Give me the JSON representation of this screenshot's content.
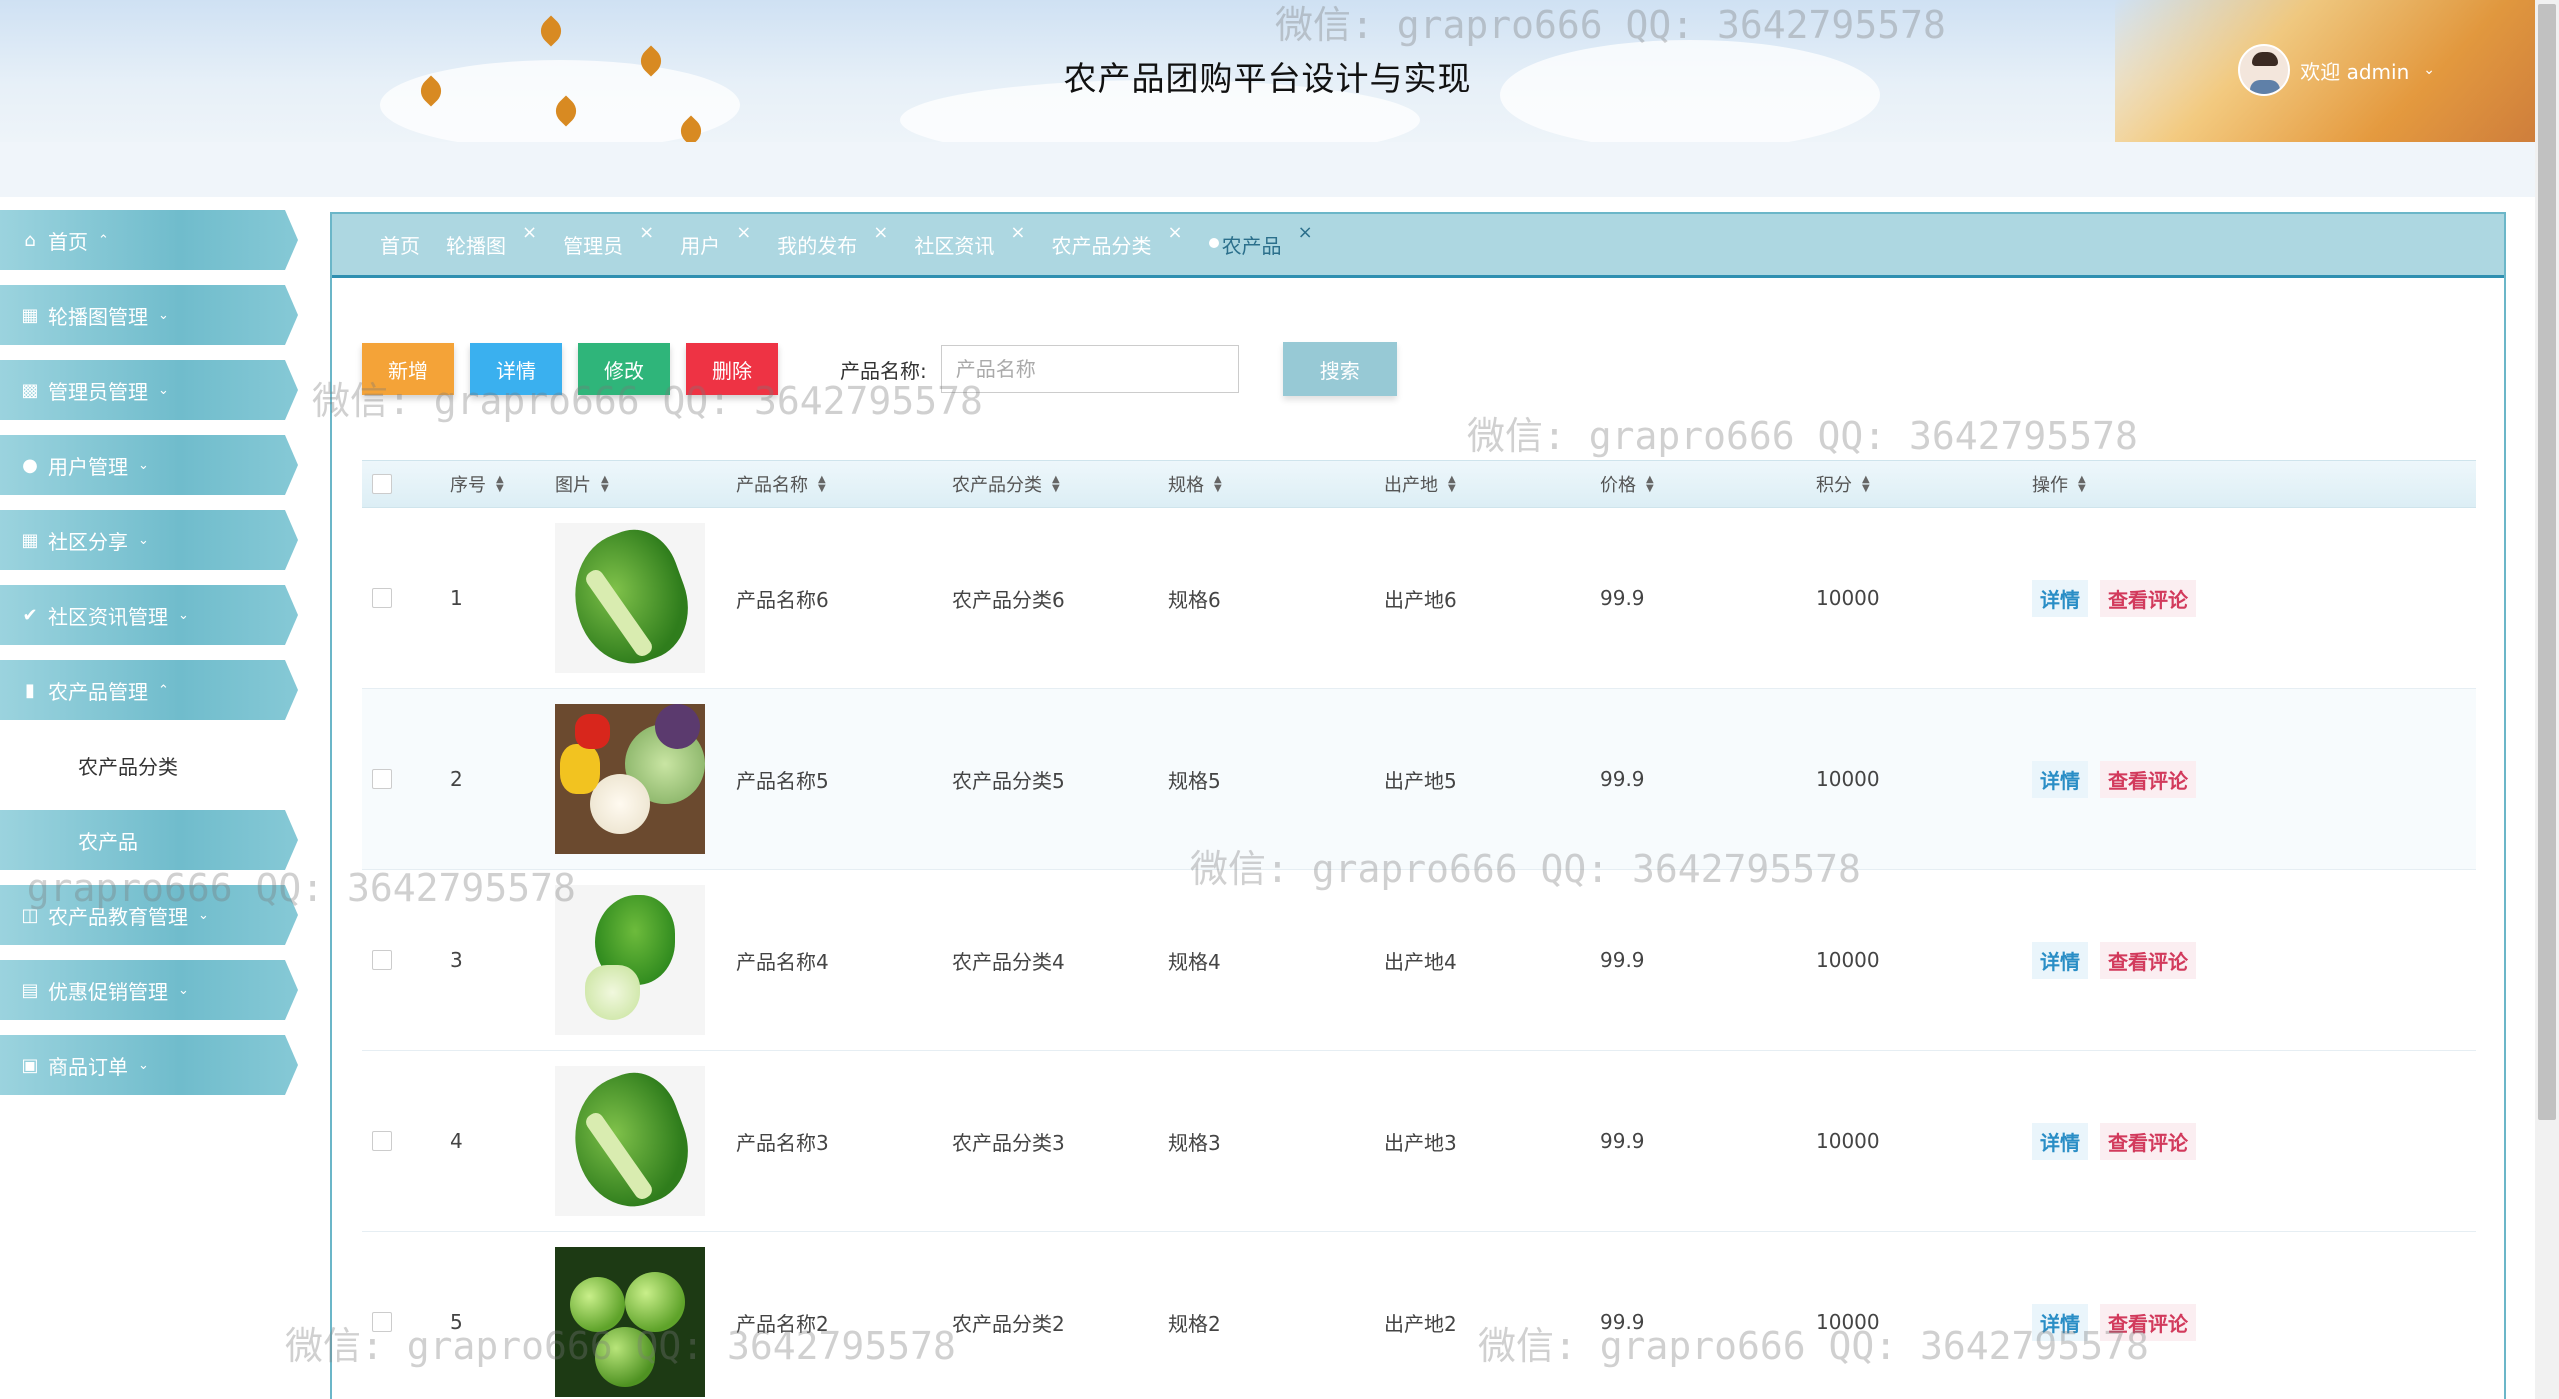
{
  "header": {
    "title": "农产品团购平台设计与实现",
    "user_greeting": "欢迎 admin"
  },
  "sidebar": {
    "items": [
      {
        "label": "首页",
        "icon": "home-icon",
        "caret": "^"
      },
      {
        "label": "轮播图管理",
        "icon": "chart-icon",
        "caret": "v"
      },
      {
        "label": "管理员管理",
        "icon": "grid-icon",
        "caret": "v"
      },
      {
        "label": "用户管理",
        "icon": "user-icon",
        "caret": "v"
      },
      {
        "label": "社区分享",
        "icon": "chart-icon",
        "caret": "v"
      },
      {
        "label": "社区资讯管理",
        "icon": "compass-icon",
        "caret": "v"
      },
      {
        "label": "农产品管理",
        "icon": "bookmark-icon",
        "caret": "^"
      }
    ],
    "sub_items": [
      {
        "label": "农产品分类"
      },
      {
        "label": "农产品"
      }
    ],
    "items_after": [
      {
        "label": "农产品教育管理",
        "icon": "panel-icon",
        "caret": "v"
      },
      {
        "label": "优惠促销管理",
        "icon": "window-icon",
        "caret": "v"
      },
      {
        "label": "商品订单",
        "icon": "crop-icon",
        "caret": "v"
      }
    ]
  },
  "tabs": [
    {
      "label": "首页",
      "closable": false
    },
    {
      "label": "轮播图",
      "closable": true
    },
    {
      "label": "管理员",
      "closable": true
    },
    {
      "label": "用户",
      "closable": true
    },
    {
      "label": "我的发布",
      "closable": true
    },
    {
      "label": "社区资讯",
      "closable": true
    },
    {
      "label": "农产品分类",
      "closable": true
    },
    {
      "label": "农产品",
      "closable": true,
      "active": true
    }
  ],
  "toolbar": {
    "add_label": "新增",
    "detail_label": "详情",
    "edit_label": "修改",
    "delete_label": "删除",
    "search_label": "产品名称:",
    "search_placeholder": "产品名称",
    "search_button": "搜索"
  },
  "table": {
    "columns": [
      "序号",
      "图片",
      "产品名称",
      "农产品分类",
      "规格",
      "出产地",
      "价格",
      "积分",
      "操作"
    ],
    "rows": [
      {
        "idx": "1",
        "image": "romaine-lettuce",
        "name": "产品名称6",
        "category": "农产品分类6",
        "spec": "规格6",
        "origin": "出产地6",
        "price": "99.9",
        "points": "10000"
      },
      {
        "idx": "2",
        "image": "mixed-vegetables",
        "name": "产品名称5",
        "category": "农产品分类5",
        "spec": "规格5",
        "origin": "出产地5",
        "price": "99.9",
        "points": "10000"
      },
      {
        "idx": "3",
        "image": "bok-choy",
        "name": "产品名称4",
        "category": "农产品分类4",
        "spec": "规格4",
        "origin": "出产地4",
        "price": "99.9",
        "points": "10000"
      },
      {
        "idx": "4",
        "image": "romaine-lettuce",
        "name": "产品名称3",
        "category": "农产品分类3",
        "spec": "规格3",
        "origin": "出产地3",
        "price": "99.9",
        "points": "10000"
      },
      {
        "idx": "5",
        "image": "green-tomatoes",
        "name": "产品名称2",
        "category": "农产品分类2",
        "spec": "规格2",
        "origin": "出产地2",
        "price": "99.9",
        "points": "10000"
      }
    ],
    "op_detail": "详情",
    "op_review": "查看评论"
  },
  "watermark": "微信: grapro666 QQ: 3642795578",
  "colors": {
    "accent": "#70bccc",
    "tab_bar": "#add7e1",
    "add": "#f4a338",
    "detail": "#3ab0ef",
    "edit": "#2fb57a",
    "delete": "#ee3344",
    "search": "#97c9d5"
  }
}
